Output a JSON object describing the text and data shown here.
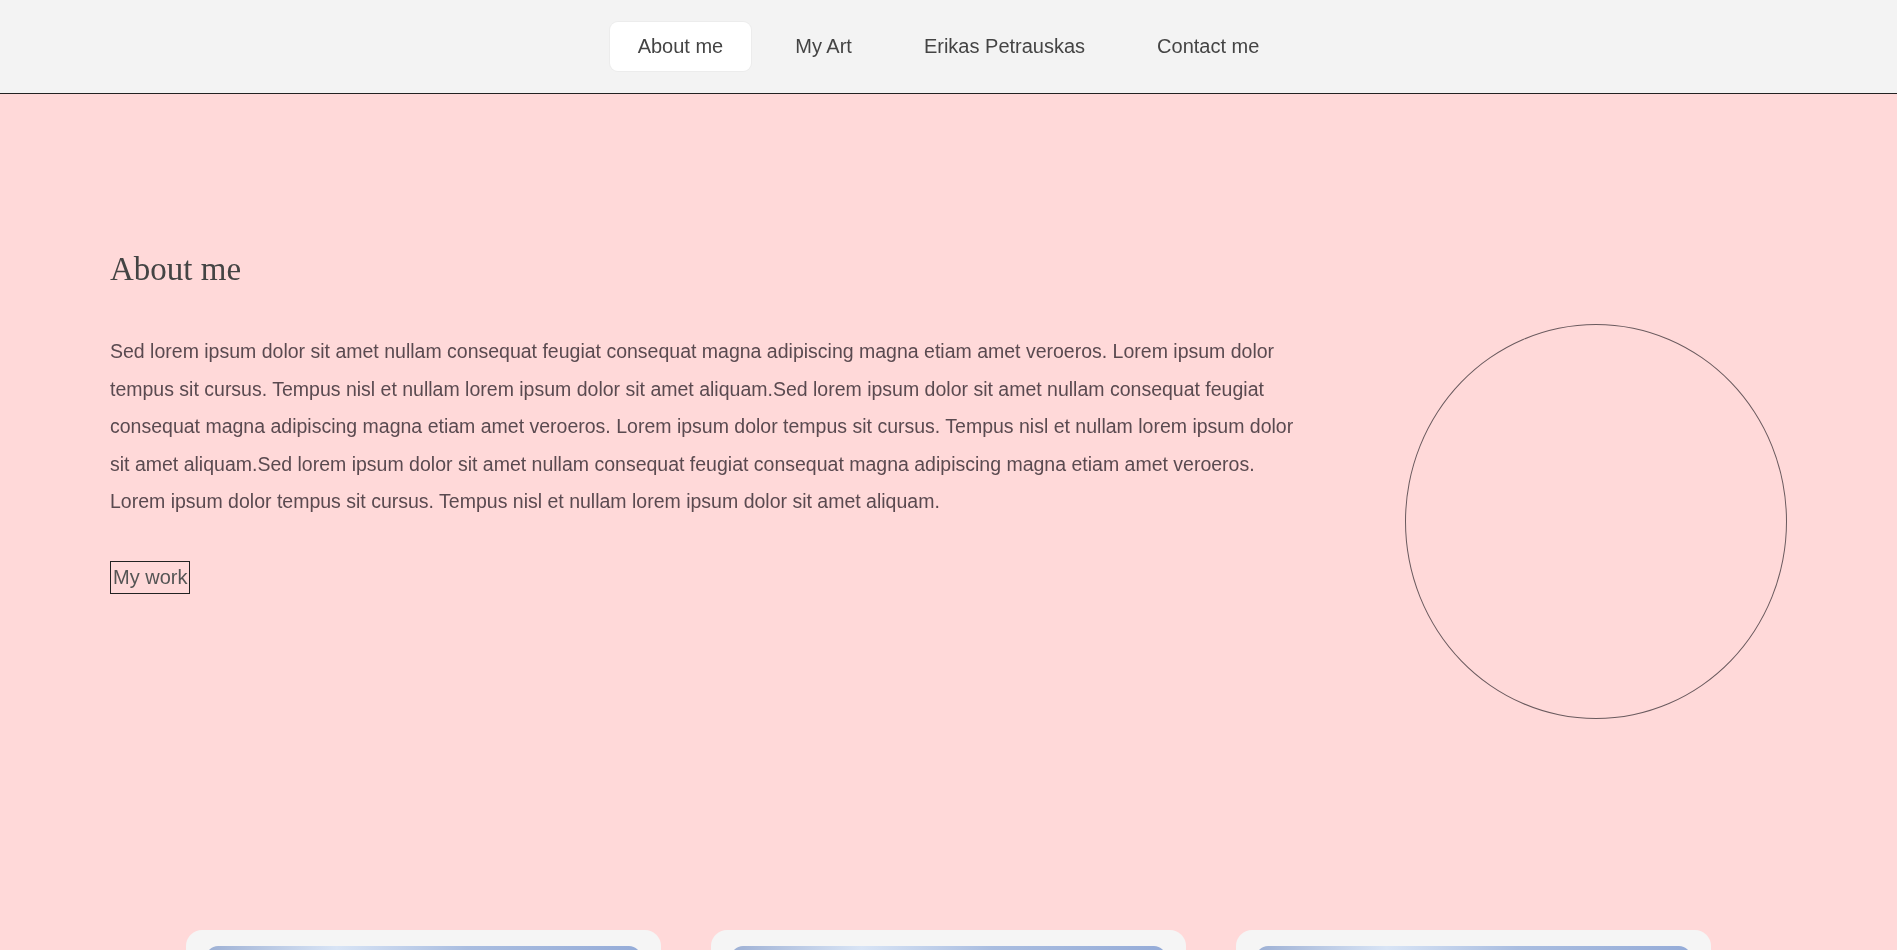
{
  "nav": {
    "items": [
      {
        "label": "About me",
        "selected": true
      },
      {
        "label": "My Art",
        "selected": false
      },
      {
        "label": "Erikas Petrauskas",
        "selected": false
      },
      {
        "label": "Contact me",
        "selected": false
      }
    ]
  },
  "about": {
    "heading": "About me",
    "text": "Sed lorem ipsum dolor sit amet nullam consequat feugiat consequat magna adipiscing magna etiam amet veroeros. Lorem ipsum dolor tempus sit cursus. Tempus nisl et nullam lorem ipsum dolor sit amet aliquam.Sed lorem ipsum dolor sit amet nullam consequat feugiat consequat magna adipiscing magna etiam amet veroeros. Lorem ipsum dolor tempus sit cursus. Tempus nisl et nullam lorem ipsum dolor sit amet aliquam.Sed lorem ipsum dolor sit amet nullam consequat feugiat consequat magna adipiscing magna etiam amet veroeros. Lorem ipsum dolor tempus sit cursus. Tempus nisl et nullam lorem ipsum dolor sit amet aliquam.",
    "button": "My work"
  },
  "cards": [
    {
      "kind": "image"
    },
    {
      "kind": "image"
    },
    {
      "kind": "image"
    }
  ]
}
